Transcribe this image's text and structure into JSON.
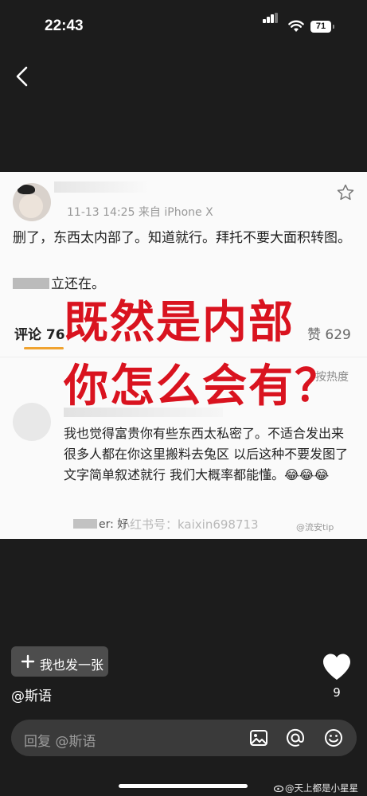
{
  "status_bar": {
    "time": "22:43",
    "battery": "71"
  },
  "post_image": {
    "meta": "11-13 14:25  来自 iPhone X",
    "body_text": "删了，东西太内部了。知道就行。拜托不要大面积转图。",
    "body_text2": "立还在。",
    "comments_label": "评论 76",
    "likes_label": "赞 629",
    "sort_label": "按热度",
    "comment_text": "我也觉得富贵你有些东西太私密了。不适合发出来 很多人都在你这里搬料去兔区 以后这种不要发图了 文字简单叙述就行 我们大概率都能懂。😂😂😂",
    "reply_text": "er: 好",
    "watermark_text": "小红书号：kaixin698713",
    "weibo_mark": "@流安tip",
    "overlay_line1": "既然是内部",
    "overlay_line2": "你怎么会有？"
  },
  "actions": {
    "add_photo_label": "我也发一张",
    "author": "@斯语",
    "like_count": "9"
  },
  "reply_bar": {
    "placeholder": "回复 @斯语"
  },
  "watermark": "@天上都是小星星",
  "colors": {
    "overlay_red": "#d9131f",
    "sort_underline": "#f0a330",
    "background": "#1c1c1c"
  },
  "icons": [
    "back-icon",
    "signal-icon",
    "wifi-icon",
    "battery-icon",
    "star-icon",
    "plus-icon",
    "heart-icon",
    "image-icon",
    "at-icon",
    "emoji-icon",
    "weibo-icon"
  ]
}
